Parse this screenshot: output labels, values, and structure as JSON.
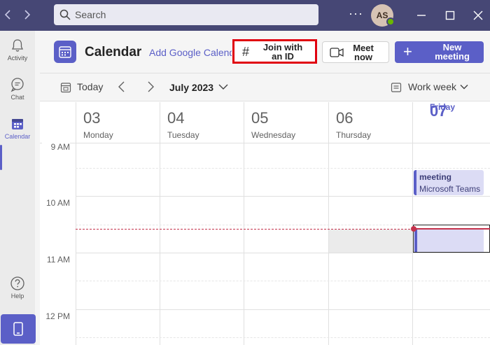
{
  "titlebar": {
    "search_placeholder": "Search",
    "more_label": "···",
    "avatar_initials": "AS",
    "presence": "available"
  },
  "rail": {
    "items": [
      {
        "label": "Activity",
        "icon": "bell-icon"
      },
      {
        "label": "Chat",
        "icon": "chat-icon"
      },
      {
        "label": "Calendar",
        "icon": "calendar-icon",
        "active": true
      },
      {
        "label": "Help",
        "icon": "help-icon"
      }
    ],
    "app_icon": "phone-icon"
  },
  "header": {
    "title": "Calendar",
    "add_google": "Add Google Calendar",
    "join_label": "Join with an ID",
    "join_icon": "#",
    "meet_label": "Meet now",
    "new_label": "New meeting",
    "new_icon": "+"
  },
  "toolbar": {
    "today_label": "Today",
    "month_label": "July 2023",
    "view_label": "Work week"
  },
  "days": [
    {
      "num": "03",
      "name": "Monday"
    },
    {
      "num": "04",
      "name": "Tuesday"
    },
    {
      "num": "05",
      "name": "Wednesday"
    },
    {
      "num": "06",
      "name": "Thursday"
    },
    {
      "num": "07",
      "name": "Friday",
      "today": true
    }
  ],
  "times": [
    "9 AM",
    "10 AM",
    "11 AM",
    "12 PM"
  ],
  "event": {
    "title": "meeting",
    "subtitle": "Microsoft Teams"
  },
  "colors": {
    "titlebar": "#464775",
    "accent": "#5b5fc7",
    "now_line": "#c4314b",
    "highlight_border": "#e0000f"
  }
}
